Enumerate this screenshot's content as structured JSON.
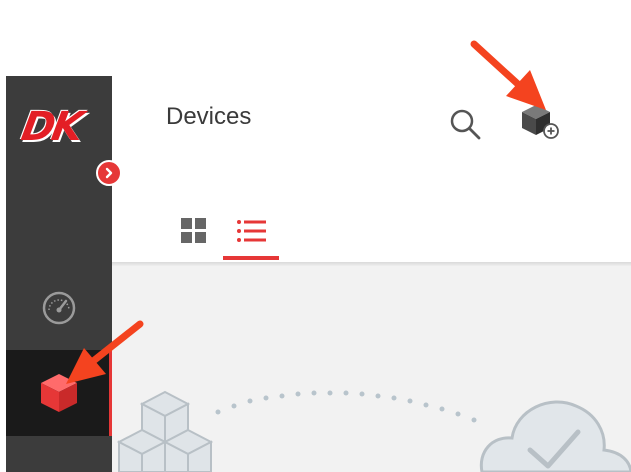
{
  "app": {
    "logo_text": "DK",
    "page_title": "Devices"
  },
  "sidebar": {
    "items": [
      {
        "name": "dashboard",
        "icon": "speedometer-icon"
      },
      {
        "name": "devices",
        "icon": "cube-icon",
        "active": true
      }
    ],
    "collapse_icon": "chevron-right-icon"
  },
  "header": {
    "actions": [
      {
        "name": "search",
        "icon": "search-icon"
      },
      {
        "name": "add-device",
        "icon": "add-device-icon"
      }
    ]
  },
  "view_toggle": {
    "options": [
      {
        "name": "grid",
        "icon": "grid-icon",
        "selected": false
      },
      {
        "name": "list",
        "icon": "list-icon",
        "selected": true
      }
    ]
  },
  "colors": {
    "accent": "#e63737",
    "sidebar": "#3c3c3c",
    "sidebar_active": "#1a1a1a",
    "annotation_arrow": "#f4431f"
  }
}
